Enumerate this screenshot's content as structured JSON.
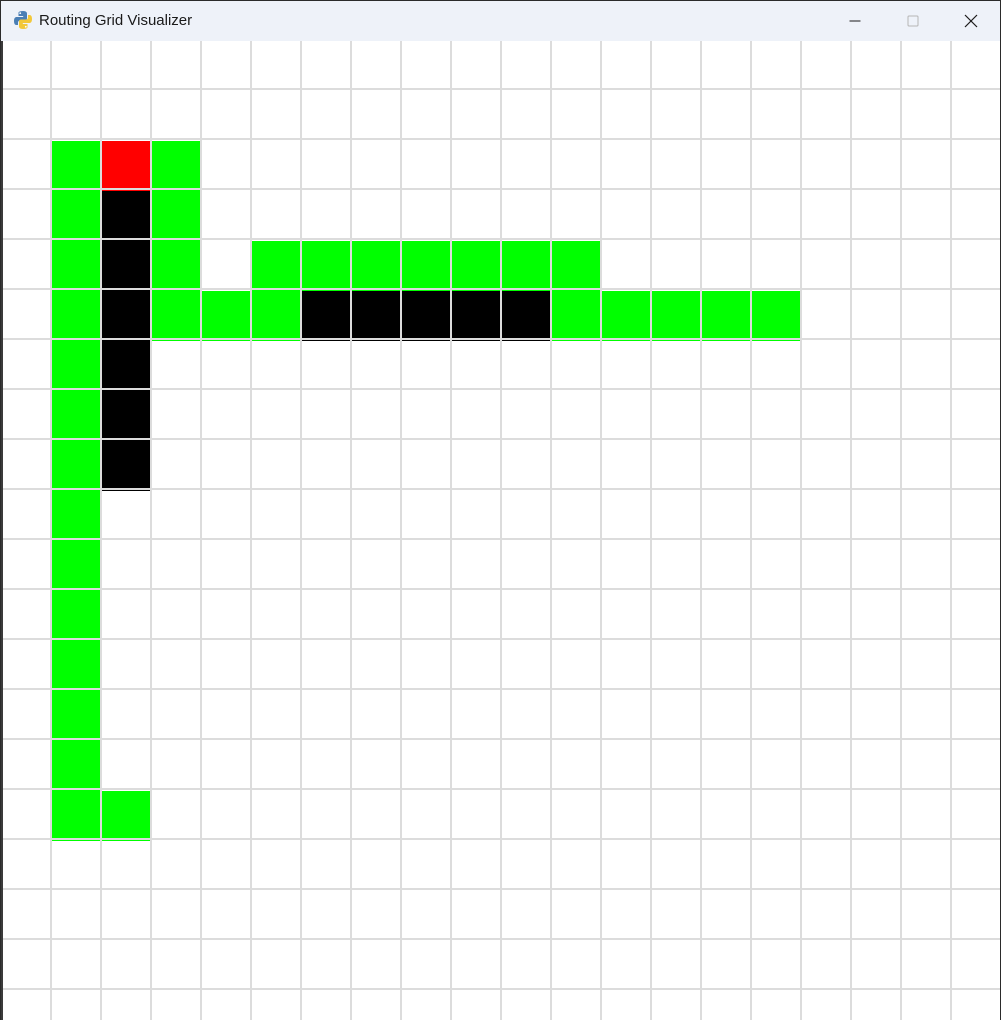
{
  "window": {
    "title": "Routing Grid Visualizer",
    "app_icon": "python-snake-icon",
    "controls": [
      "minimize-icon",
      "maximize-icon",
      "close-icon"
    ]
  },
  "grid": {
    "columns": 20,
    "rows_visible": 20,
    "background_color": "#ffffff",
    "line_color": "#dcdcdc",
    "cell_colors": {
      "green": "#00ff00",
      "black": "#000000",
      "red": "#ff0000"
    },
    "cells": [
      {
        "col": 1,
        "row": 2,
        "state": "green"
      },
      {
        "col": 2,
        "row": 2,
        "state": "red"
      },
      {
        "col": 3,
        "row": 2,
        "state": "green"
      },
      {
        "col": 1,
        "row": 3,
        "state": "green"
      },
      {
        "col": 2,
        "row": 3,
        "state": "black"
      },
      {
        "col": 3,
        "row": 3,
        "state": "green"
      },
      {
        "col": 1,
        "row": 4,
        "state": "green"
      },
      {
        "col": 2,
        "row": 4,
        "state": "black"
      },
      {
        "col": 3,
        "row": 4,
        "state": "green"
      },
      {
        "col": 5,
        "row": 4,
        "state": "green"
      },
      {
        "col": 6,
        "row": 4,
        "state": "green"
      },
      {
        "col": 7,
        "row": 4,
        "state": "green"
      },
      {
        "col": 8,
        "row": 4,
        "state": "green"
      },
      {
        "col": 9,
        "row": 4,
        "state": "green"
      },
      {
        "col": 10,
        "row": 4,
        "state": "green"
      },
      {
        "col": 11,
        "row": 4,
        "state": "green"
      },
      {
        "col": 1,
        "row": 5,
        "state": "green"
      },
      {
        "col": 2,
        "row": 5,
        "state": "black"
      },
      {
        "col": 3,
        "row": 5,
        "state": "green"
      },
      {
        "col": 4,
        "row": 5,
        "state": "green"
      },
      {
        "col": 5,
        "row": 5,
        "state": "green"
      },
      {
        "col": 6,
        "row": 5,
        "state": "black"
      },
      {
        "col": 7,
        "row": 5,
        "state": "black"
      },
      {
        "col": 8,
        "row": 5,
        "state": "black"
      },
      {
        "col": 9,
        "row": 5,
        "state": "black"
      },
      {
        "col": 10,
        "row": 5,
        "state": "black"
      },
      {
        "col": 11,
        "row": 5,
        "state": "green"
      },
      {
        "col": 12,
        "row": 5,
        "state": "green"
      },
      {
        "col": 13,
        "row": 5,
        "state": "green"
      },
      {
        "col": 14,
        "row": 5,
        "state": "green"
      },
      {
        "col": 15,
        "row": 5,
        "state": "green"
      },
      {
        "col": 1,
        "row": 6,
        "state": "green"
      },
      {
        "col": 2,
        "row": 6,
        "state": "black"
      },
      {
        "col": 1,
        "row": 7,
        "state": "green"
      },
      {
        "col": 2,
        "row": 7,
        "state": "black"
      },
      {
        "col": 1,
        "row": 8,
        "state": "green"
      },
      {
        "col": 2,
        "row": 8,
        "state": "black"
      },
      {
        "col": 1,
        "row": 9,
        "state": "green"
      },
      {
        "col": 1,
        "row": 10,
        "state": "green"
      },
      {
        "col": 1,
        "row": 11,
        "state": "green"
      },
      {
        "col": 1,
        "row": 12,
        "state": "green"
      },
      {
        "col": 1,
        "row": 13,
        "state": "green"
      },
      {
        "col": 1,
        "row": 14,
        "state": "green"
      },
      {
        "col": 1,
        "row": 15,
        "state": "green"
      },
      {
        "col": 2,
        "row": 15,
        "state": "green"
      }
    ]
  }
}
